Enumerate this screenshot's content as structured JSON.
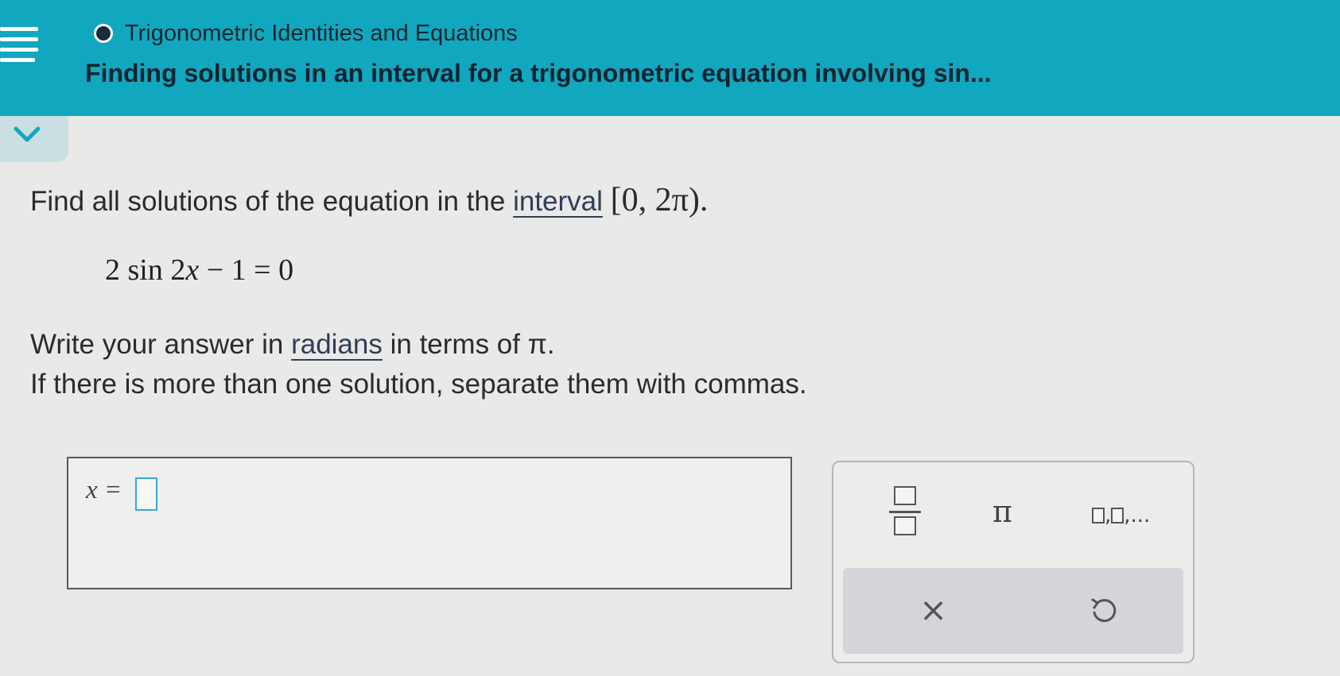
{
  "header": {
    "topic": "Trigonometric Identities and Equations",
    "lesson_title": "Finding solutions in an interval for a trigonometric equation involving sin..."
  },
  "question": {
    "prompt_start": "Find all solutions of the equation in the ",
    "interval_link": "interval",
    "interval": "[0, 2π).",
    "equation": {
      "coef": "2 sin 2",
      "var": "x",
      "rest": " − 1 = 0"
    },
    "instruction_start": "Write your answer in ",
    "radians_link": "radians",
    "instruction_end": " in terms of π.",
    "instruction_2": "If there is more than one solution, separate them with commas."
  },
  "answer": {
    "label": "x =",
    "value": ""
  },
  "keypad": {
    "pi": "π",
    "sequence_suffix": ",...",
    "clear": "×"
  },
  "icons": {
    "menu": "hamburger-menu-icon",
    "collapse": "chevron-down-icon",
    "fraction": "fraction-icon",
    "sequence": "sequence-icon",
    "undo": "undo-icon"
  },
  "colors": {
    "header": "#11a7bf",
    "background": "#e9e9e7",
    "input_border": "#3aa7d9"
  }
}
